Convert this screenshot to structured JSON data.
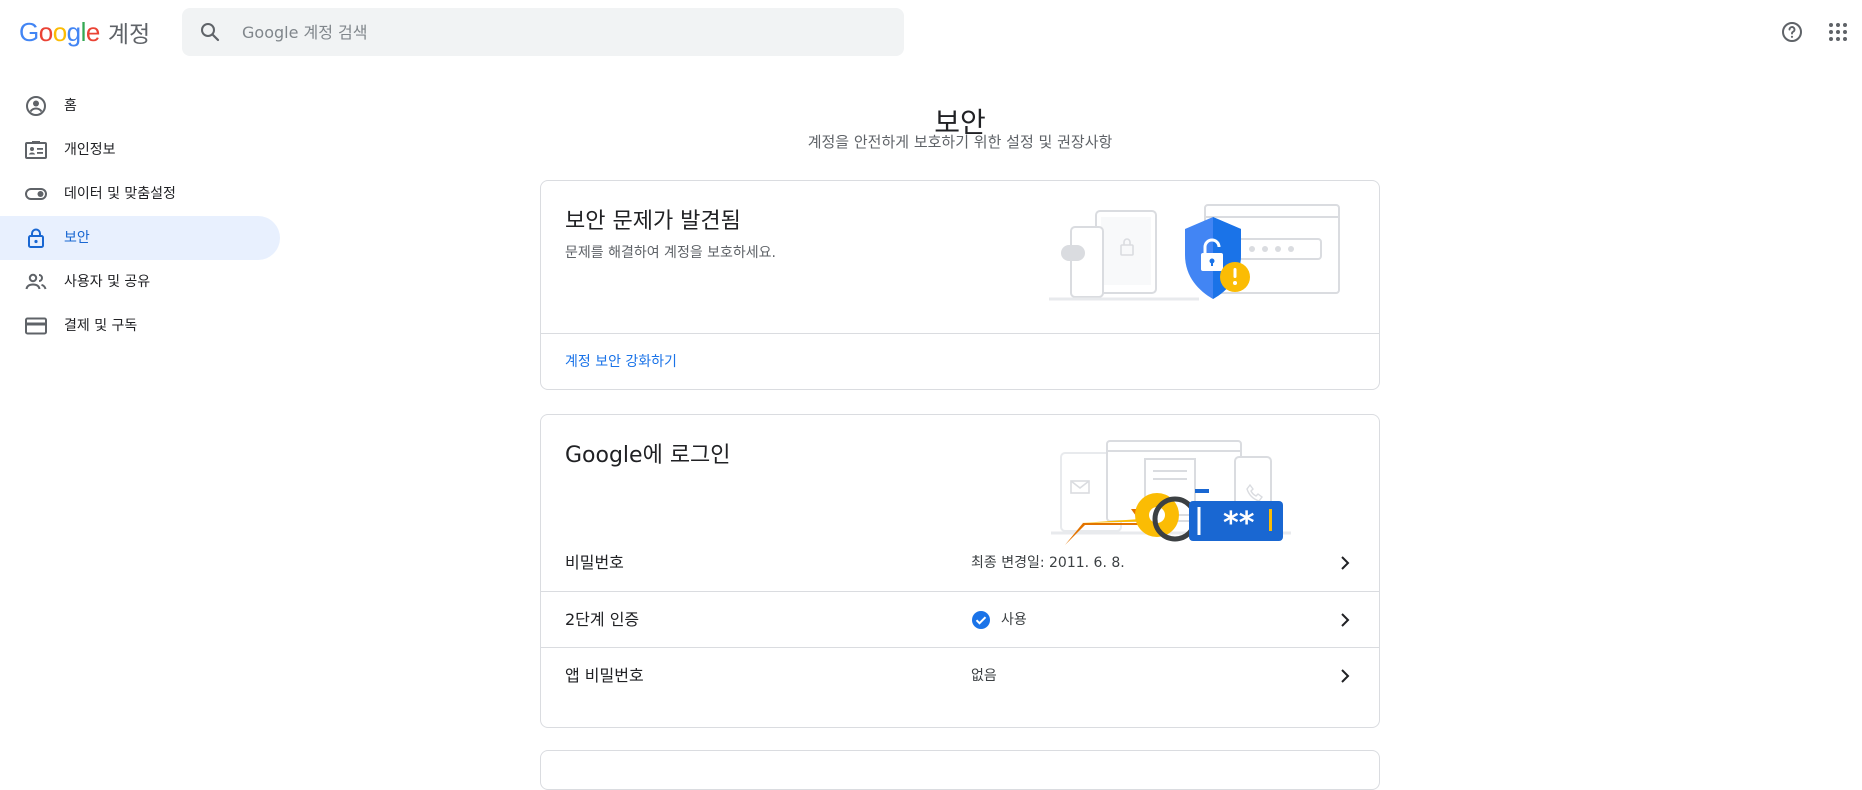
{
  "header": {
    "logo_text": "Google",
    "product_name": "계정",
    "search_placeholder": "Google 계정 검색"
  },
  "sidebar": {
    "items": [
      {
        "label": "홈",
        "icon": "account-circle-icon"
      },
      {
        "label": "개인정보",
        "icon": "id-card-icon"
      },
      {
        "label": "데이터 및 맞춤설정",
        "icon": "toggle-icon"
      },
      {
        "label": "보안",
        "icon": "lock-icon",
        "active": true
      },
      {
        "label": "사용자 및 공유",
        "icon": "people-icon"
      },
      {
        "label": "결제 및 구독",
        "icon": "credit-card-icon"
      }
    ]
  },
  "main": {
    "title": "보안",
    "subtitle": "계정을 안전하게 보호하기 위한 설정 및 권장사항",
    "issues_card": {
      "title": "보안 문제가 발견됨",
      "description": "문제를 해결하여 계정을 보호하세요.",
      "link": "계정 보안 강화하기"
    },
    "signin_card": {
      "title": "Google에 로그인",
      "illustration_password_mask": "**",
      "rows": [
        {
          "label": "비밀번호",
          "value": "최종 변경일: 2011. 6. 8."
        },
        {
          "label": "2단계 인증",
          "value": "사용",
          "status_icon": "check-circle-icon"
        },
        {
          "label": "앱 비밀번호",
          "value": "없음"
        }
      ]
    }
  },
  "colors": {
    "accent": "#1a73e8",
    "active_bg": "#e8f0fe",
    "warning": "#fbbc04",
    "shield": "#4285f4"
  }
}
